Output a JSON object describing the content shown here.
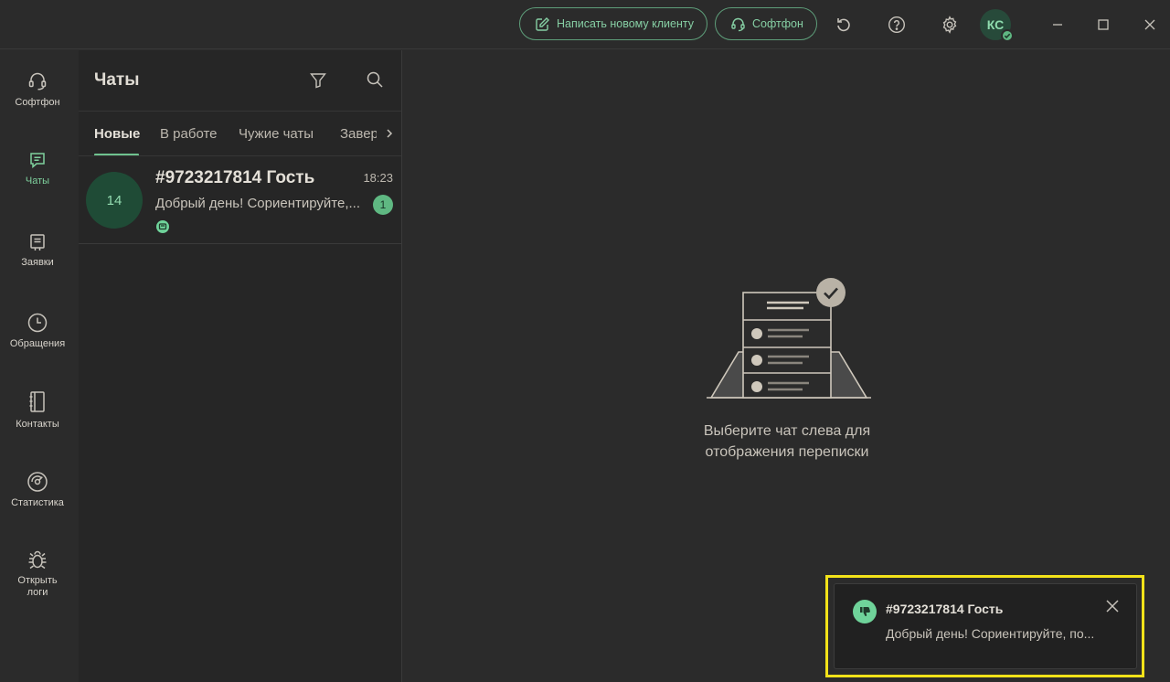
{
  "topbar": {
    "new_client_label": "Написать новому клиенту",
    "softphone_label": "Софтфон",
    "avatar_initials": "КС",
    "icons": [
      "pencil-square-icon",
      "headset-icon",
      "refresh-icon",
      "help-icon",
      "gear-icon",
      "minimize-icon",
      "maximize-icon",
      "close-icon"
    ]
  },
  "sidebar": {
    "items": [
      {
        "label": "Софтфон",
        "icon": "headset-icon",
        "active": false
      },
      {
        "label": "Чаты",
        "icon": "chat-icon",
        "active": true
      },
      {
        "label": "Заявки",
        "icon": "ticket-icon",
        "active": false
      },
      {
        "label": "Обращения",
        "icon": "clock-icon",
        "active": false
      },
      {
        "label": "Контакты",
        "icon": "notebook-icon",
        "active": false
      },
      {
        "label": "Статистика",
        "icon": "gauge-icon",
        "active": false
      },
      {
        "label_line1": "Открыть",
        "label_line2": "логи",
        "icon": "bug-icon",
        "active": false
      }
    ]
  },
  "chats_panel": {
    "title": "Чаты",
    "tabs": [
      {
        "label": "Новые",
        "active": true
      },
      {
        "label": "В работе",
        "active": false
      },
      {
        "label": "Чужие чаты",
        "active": false
      },
      {
        "label": "Завер",
        "active": false
      }
    ],
    "chat_list": [
      {
        "avatar_text": "14",
        "name": "#9723217814 Гость",
        "time": "18:23",
        "preview": "Добрый день! Сориентируйте,...",
        "unread": "1",
        "channel_icon": "web-chat-icon"
      }
    ]
  },
  "main": {
    "empty_line1": "Выберите чат слева для",
    "empty_line2": "отображения переписки"
  },
  "toast": {
    "title": "#9723217814 Гость",
    "body": "Добрый день! Сориентируйте, по...",
    "icon": "thumbs-down-icon"
  },
  "colors": {
    "accent": "#6fc28f",
    "background": "#2b2b2b",
    "panel": "#262626",
    "highlight_frame": "#f2e219"
  }
}
